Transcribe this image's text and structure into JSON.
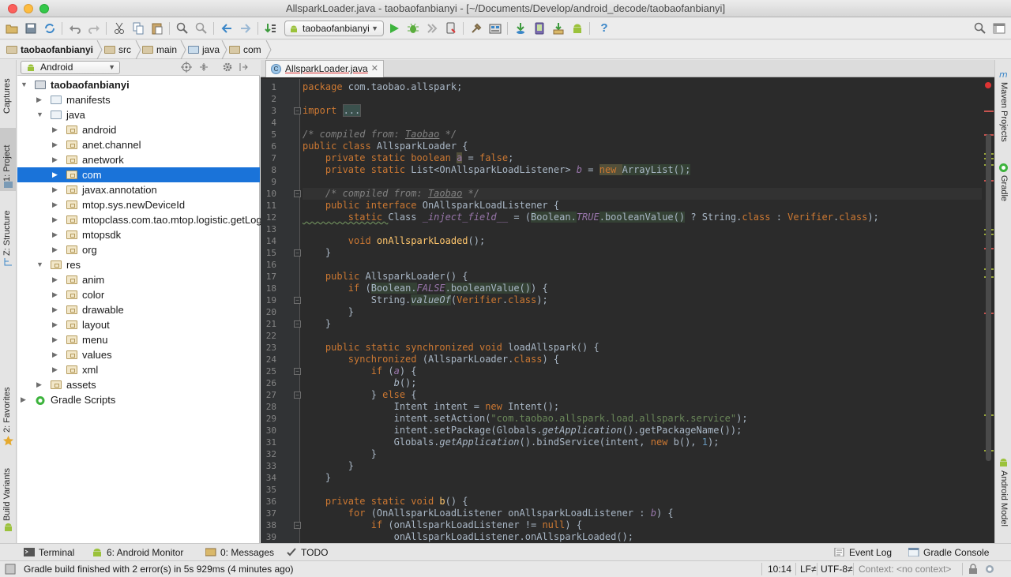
{
  "window": {
    "title": "AllsparkLoader.java - taobaofanbianyi - [~/Documents/Develop/android_decode/taobaofanbianyi]"
  },
  "toolbar": {
    "run_config": "taobaofanbianyi"
  },
  "breadcrumbs": [
    "taobaofanbianyi",
    "src",
    "main",
    "java",
    "com"
  ],
  "left_tabs": [
    "Captures",
    "1: Project",
    "Z: Structure",
    "2: Favorites",
    "Build Variants"
  ],
  "right_tabs": [
    "Maven Projects",
    "Gradle",
    "Android Model"
  ],
  "project": {
    "view": "Android",
    "tree": [
      {
        "label": "taobaofanbianyi",
        "depth": 0,
        "expanded": true,
        "icon": "module-folder-icon",
        "bold": true
      },
      {
        "label": "manifests",
        "depth": 1,
        "expanded": false,
        "icon": "folder-icon"
      },
      {
        "label": "java",
        "depth": 1,
        "expanded": true,
        "icon": "folder-icon"
      },
      {
        "label": "android",
        "depth": 2,
        "expanded": false,
        "icon": "package-icon"
      },
      {
        "label": "anet.channel",
        "depth": 2,
        "expanded": false,
        "icon": "package-icon"
      },
      {
        "label": "anetwork",
        "depth": 2,
        "expanded": false,
        "icon": "package-icon"
      },
      {
        "label": "com",
        "depth": 2,
        "expanded": false,
        "icon": "package-icon",
        "selected": true
      },
      {
        "label": "javax.annotation",
        "depth": 2,
        "expanded": false,
        "icon": "package-icon"
      },
      {
        "label": "mtop.sys.newDeviceId",
        "depth": 2,
        "expanded": false,
        "icon": "package-icon"
      },
      {
        "label": "mtopclass.com.tao.mtop.logistic.getLog",
        "depth": 2,
        "expanded": false,
        "icon": "package-icon"
      },
      {
        "label": "mtopsdk",
        "depth": 2,
        "expanded": false,
        "icon": "package-icon"
      },
      {
        "label": "org",
        "depth": 2,
        "expanded": false,
        "icon": "package-icon"
      },
      {
        "label": "res",
        "depth": 1,
        "expanded": true,
        "icon": "package-icon"
      },
      {
        "label": "anim",
        "depth": 2,
        "expanded": false,
        "icon": "package-icon"
      },
      {
        "label": "color",
        "depth": 2,
        "expanded": false,
        "icon": "package-icon"
      },
      {
        "label": "drawable",
        "depth": 2,
        "expanded": false,
        "icon": "package-icon"
      },
      {
        "label": "layout",
        "depth": 2,
        "expanded": false,
        "icon": "package-icon"
      },
      {
        "label": "menu",
        "depth": 2,
        "expanded": false,
        "icon": "package-icon"
      },
      {
        "label": "values",
        "depth": 2,
        "expanded": false,
        "icon": "package-icon"
      },
      {
        "label": "xml",
        "depth": 2,
        "expanded": false,
        "icon": "package-icon"
      },
      {
        "label": "assets",
        "depth": 1,
        "expanded": false,
        "icon": "package-icon"
      },
      {
        "label": "Gradle Scripts",
        "depth": 0,
        "expanded": false,
        "icon": "gradle-icon"
      }
    ]
  },
  "editor": {
    "tab": "AllsparkLoader.java",
    "current_line": 10,
    "lines": [
      [
        [
          "package ",
          "kw"
        ],
        [
          "com.taobao.allspark;",
          "tx"
        ]
      ],
      [],
      [
        [
          "import ",
          "kw"
        ],
        [
          "...",
          "fold"
        ]
      ],
      [],
      [
        [
          "/* compiled from: ",
          "cm"
        ],
        [
          "Taobao",
          "cmu"
        ],
        [
          " */",
          "cm"
        ]
      ],
      [
        [
          "public class ",
          "kw"
        ],
        [
          "AllsparkLoader",
          "tx"
        ],
        [
          " {",
          "tx"
        ]
      ],
      [
        [
          "    private static boolean ",
          "kw"
        ],
        [
          "a",
          "fldh"
        ],
        [
          " = ",
          "tx"
        ],
        [
          "false",
          "kw"
        ],
        [
          ";",
          "tx"
        ]
      ],
      [
        [
          "    private static ",
          "kw"
        ],
        [
          "List<OnAllsparkLoadListener> ",
          "tx"
        ],
        [
          "b",
          "fld"
        ],
        [
          " = ",
          "tx"
        ],
        [
          "new ",
          "kwh"
        ],
        [
          "ArrayList();",
          "th"
        ]
      ],
      [],
      [
        [
          "    /* compiled from: ",
          "cm"
        ],
        [
          "Taobao",
          "cmu"
        ],
        [
          " */",
          "cm"
        ]
      ],
      [
        [
          "    public interface ",
          "kw"
        ],
        [
          "OnAllsparkLoadListener {",
          "tx"
        ]
      ],
      [
        [
          "        static ",
          "kwu"
        ],
        [
          "Class ",
          "tx"
        ],
        [
          "_inject_field__",
          "fld"
        ],
        [
          " = (",
          "tx"
        ],
        [
          "Boolean.",
          "th"
        ],
        [
          "TRUE",
          "cst"
        ],
        [
          ".booleanValue()",
          "th"
        ],
        [
          " ? String.",
          "tx"
        ],
        [
          "class",
          "kw"
        ],
        [
          " : ",
          "tx"
        ],
        [
          "Verifier",
          "kw"
        ],
        [
          ".",
          "tx"
        ],
        [
          "class",
          "kw"
        ],
        [
          ");",
          "tx"
        ]
      ],
      [],
      [
        [
          "        void ",
          "kw"
        ],
        [
          "onAllsparkLoaded",
          "fn"
        ],
        [
          "();",
          "tx"
        ]
      ],
      [
        [
          "    }",
          "tx"
        ]
      ],
      [],
      [
        [
          "    public ",
          "kw"
        ],
        [
          "AllsparkLoader() {",
          "tx"
        ]
      ],
      [
        [
          "        if ",
          "kw"
        ],
        [
          "(",
          "tx"
        ],
        [
          "Boolean.",
          "th"
        ],
        [
          "FALSE",
          "cst"
        ],
        [
          ".booleanValue()",
          "th"
        ],
        [
          ") {",
          "tx"
        ]
      ],
      [
        [
          "            String.",
          "tx"
        ],
        [
          "valueOf",
          "fnh"
        ],
        [
          "(",
          "tx"
        ],
        [
          "Verifier",
          "kw"
        ],
        [
          ".",
          "tx"
        ],
        [
          "class",
          "kw"
        ],
        [
          ");",
          "tx"
        ]
      ],
      [
        [
          "        }",
          "tx"
        ]
      ],
      [
        [
          "    }",
          "tx"
        ]
      ],
      [],
      [
        [
          "    public static synchronized void ",
          "kw"
        ],
        [
          "loadAllspark",
          "tx"
        ],
        [
          "() {",
          "tx"
        ]
      ],
      [
        [
          "        synchronized ",
          "kw"
        ],
        [
          "(AllsparkLoader.",
          "tx"
        ],
        [
          "class",
          "kw"
        ],
        [
          ") {",
          "tx"
        ]
      ],
      [
        [
          "            if ",
          "kw"
        ],
        [
          "(",
          "tx"
        ],
        [
          "a",
          "fld"
        ],
        [
          ") {",
          "tx"
        ]
      ],
      [
        [
          "                ",
          "tx"
        ],
        [
          "b",
          "fn2"
        ],
        [
          "();",
          "tx"
        ]
      ],
      [
        [
          "            } ",
          "tx"
        ],
        [
          "else ",
          "kw"
        ],
        [
          "{",
          "tx"
        ]
      ],
      [
        [
          "                Intent intent = ",
          "tx"
        ],
        [
          "new ",
          "kw"
        ],
        [
          "Intent();",
          "tx"
        ]
      ],
      [
        [
          "                intent.setAction(",
          "tx"
        ],
        [
          "\"com.taobao.allspark.load.allspark.service\"",
          "str"
        ],
        [
          ");",
          "tx"
        ]
      ],
      [
        [
          "                intent.setPackage(Globals.",
          "tx"
        ],
        [
          "getApplication",
          "fn2"
        ],
        [
          "().getPackageName());",
          "tx"
        ]
      ],
      [
        [
          "                Globals.",
          "tx"
        ],
        [
          "getApplication",
          "fn2"
        ],
        [
          "().bindService(intent, ",
          "tx"
        ],
        [
          "new ",
          "kw"
        ],
        [
          "b(), ",
          "tx"
        ],
        [
          "1",
          "num"
        ],
        [
          ");",
          "tx"
        ]
      ],
      [
        [
          "            }",
          "tx"
        ]
      ],
      [
        [
          "        }",
          "tx"
        ]
      ],
      [
        [
          "    }",
          "tx"
        ]
      ],
      [],
      [
        [
          "    private static void ",
          "kw"
        ],
        [
          "b",
          "fn"
        ],
        [
          "() {",
          "tx"
        ]
      ],
      [
        [
          "        for ",
          "kw"
        ],
        [
          "(OnAllsparkLoadListener onAllsparkLoadListener : ",
          "tx"
        ],
        [
          "b",
          "fld"
        ],
        [
          ") {",
          "tx"
        ]
      ],
      [
        [
          "            if ",
          "kw"
        ],
        [
          "(onAllsparkLoadListener != ",
          "tx"
        ],
        [
          "null",
          "kw"
        ],
        [
          ") {",
          "tx"
        ]
      ],
      [
        [
          "                onAllsparkLoadListener.onAllsparkLoaded();",
          "tx"
        ]
      ]
    ]
  },
  "bottom_tabs": [
    "Terminal",
    "6: Android Monitor",
    "0: Messages",
    "TODO"
  ],
  "bottom_right_tabs": [
    "Event Log",
    "Gradle Console"
  ],
  "status": {
    "message": "Gradle build finished with 2 error(s) in 5s 929ms (4 minutes ago)",
    "position": "10:14",
    "line_sep": "LF≠",
    "encoding": "UTF-8≠",
    "context": "Context: <no context>"
  },
  "colors": {
    "keyword": "#cc7832",
    "text": "#a9b7c6",
    "comment": "#808080",
    "string": "#6a8759",
    "field": "#9876aa",
    "function": "#ffc66d",
    "number": "#6897bb",
    "selection": "#1a73d9"
  }
}
